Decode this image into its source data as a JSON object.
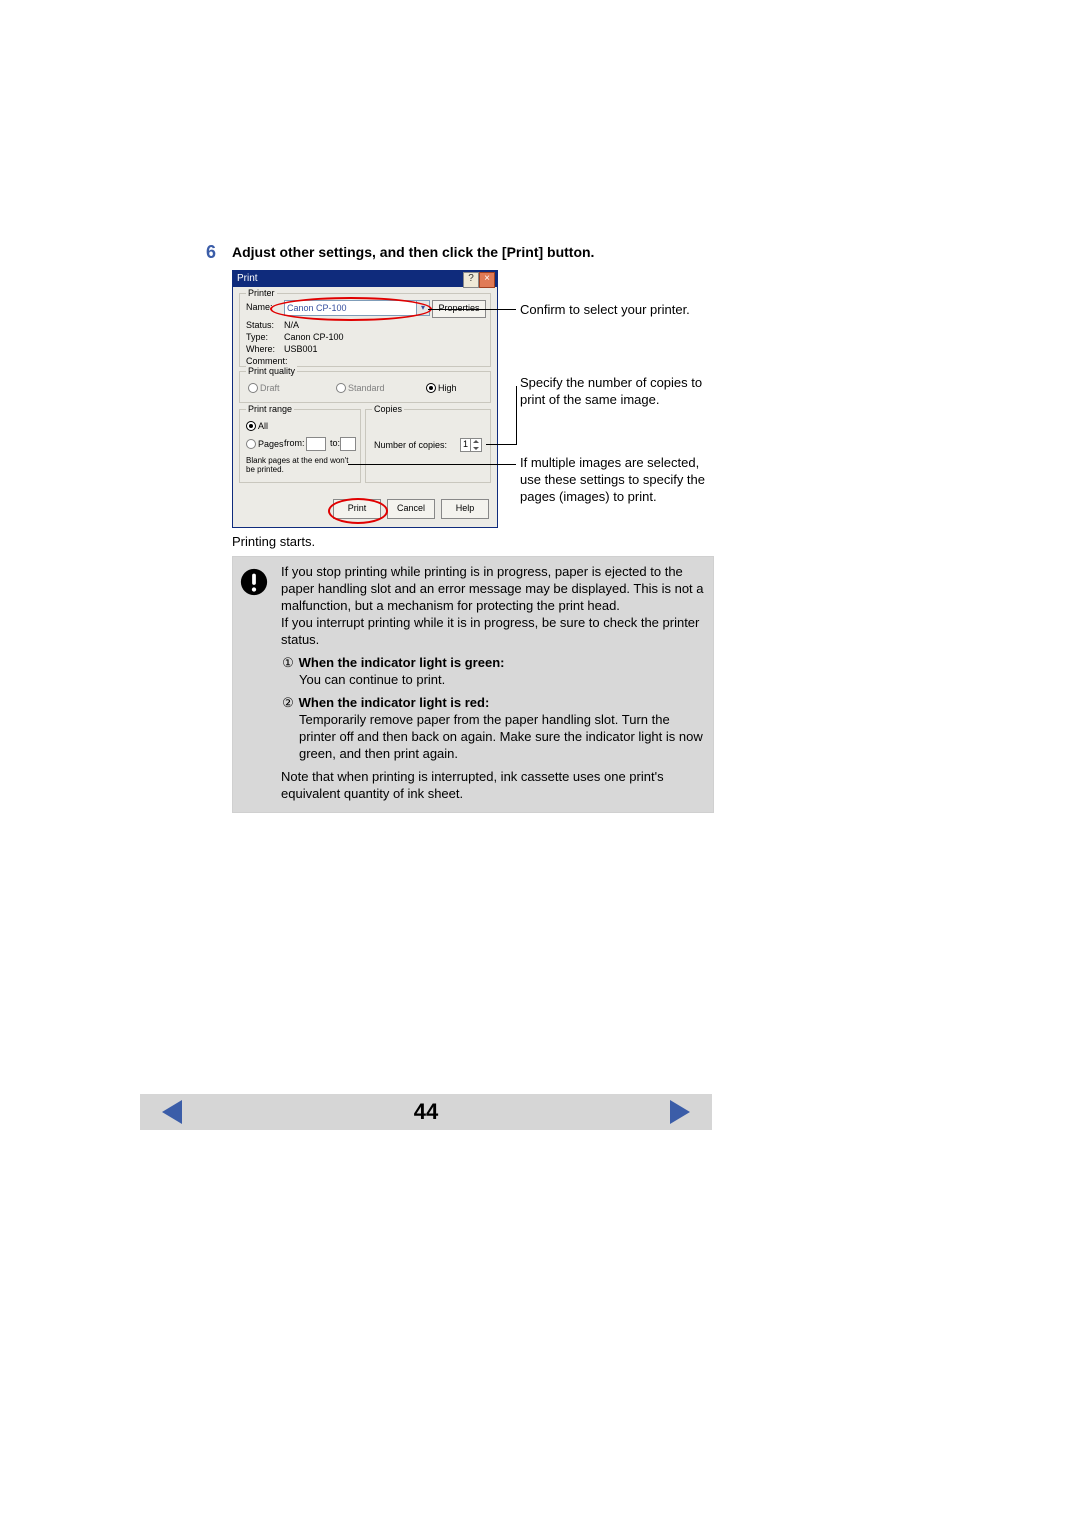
{
  "step_number": "6",
  "step_heading": "Adjust other settings, and then click the [Print] button.",
  "dialog": {
    "title": "Print",
    "group_printer_title": "Printer",
    "name_label": "Name:",
    "name_value": "Canon CP-100",
    "properties_btn": "Properties",
    "status_label": "Status:",
    "status_value": "N/A",
    "type_label": "Type:",
    "type_value": "Canon CP-100",
    "where_label": "Where:",
    "where_value": "USB001",
    "comment_label": "Comment:",
    "group_quality_title": "Print quality",
    "q_draft": "Draft",
    "q_standard": "Standard",
    "q_high": "High",
    "group_range_title": "Print range",
    "r_all": "All",
    "r_pages": "Pages",
    "r_from": "from:",
    "r_to": "to:",
    "blank_note": "Blank pages at the end won't be printed.",
    "group_copies_title": "Copies",
    "copies_label": "Number of copies:",
    "copies_value": "1",
    "btn_print": "Print",
    "btn_cancel": "Cancel",
    "btn_help": "Help"
  },
  "callouts": {
    "c1": "Confirm to select your printer.",
    "c2": "Specify the number of copies to print of the same image.",
    "c3": "If multiple images are selected, use these settings to specify the pages (images) to print."
  },
  "after_screenshot": "Printing starts.",
  "panel": {
    "p1": "If you stop printing while printing is in progress, paper is ejected to the paper handling slot and an error message may be displayed. This is not a malfunction, but a mechanism for protecting the print head.",
    "p2": "If you interrupt printing while it is in progress, be sure to check the printer status.",
    "green_title": "When the indicator light is green:",
    "green_body": "You can continue to print.",
    "red_title": "When the indicator light is red:",
    "red_body": "Temporarily remove paper from the paper handling slot. Turn the printer off and then back on again. Make sure the indicator light is now green, and then print again.",
    "note": "Note that when printing is interrupted, ink cassette uses one print's equivalent quantity of ink sheet.",
    "mark1": "①",
    "mark2": "②"
  },
  "page_number": "44"
}
